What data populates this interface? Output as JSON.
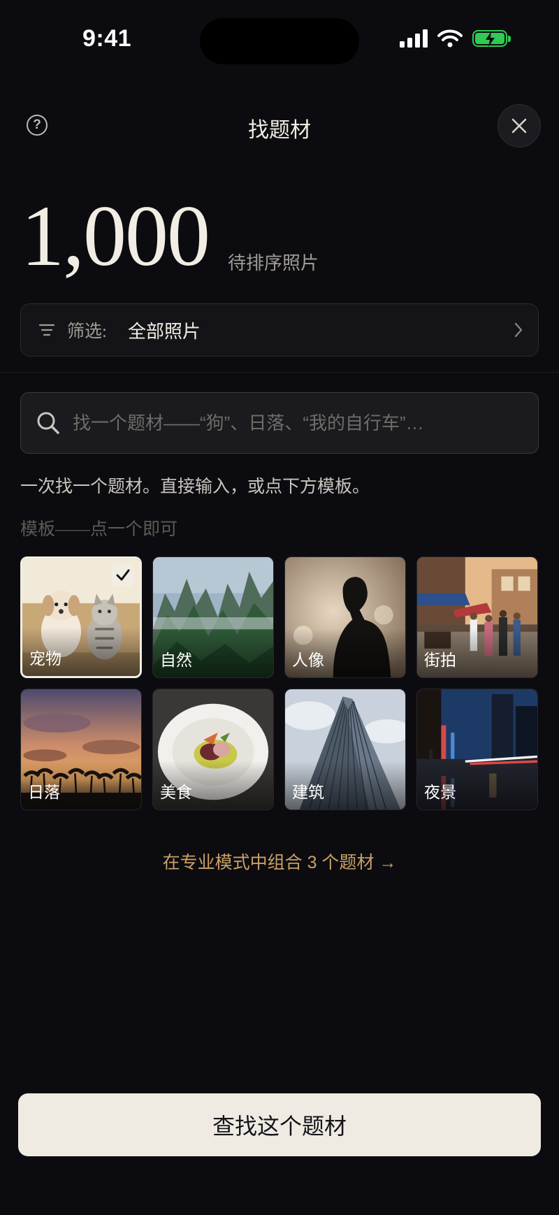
{
  "status_bar": {
    "time": "9:41"
  },
  "header": {
    "title": "找题材",
    "help_icon": "question-circle-icon",
    "close_icon": "close-icon"
  },
  "count": {
    "value": "1,000",
    "label": "待排序照片"
  },
  "filter": {
    "label": "筛选:",
    "value": "全部照片"
  },
  "search": {
    "placeholder": "找一个题材——“狗”、日落、“我的自行车”…"
  },
  "hint": "一次找一个题材。直接输入，或点下方模板。",
  "templates_label": "模板——点一个即可",
  "templates": [
    {
      "label": "宠物",
      "selected": true
    },
    {
      "label": "自然",
      "selected": false
    },
    {
      "label": "人像",
      "selected": false
    },
    {
      "label": "街拍",
      "selected": false
    },
    {
      "label": "日落",
      "selected": false
    },
    {
      "label": "美食",
      "selected": false
    },
    {
      "label": "建筑",
      "selected": false
    },
    {
      "label": "夜景",
      "selected": false
    }
  ],
  "pro_link": "在专业模式中组合 3 个题材 →",
  "cta": "查找这个题材",
  "colors": {
    "background": "#0c0c10",
    "accent": "#c9a066",
    "cta_bg": "#efebe3",
    "battery": "#2ecc52"
  }
}
